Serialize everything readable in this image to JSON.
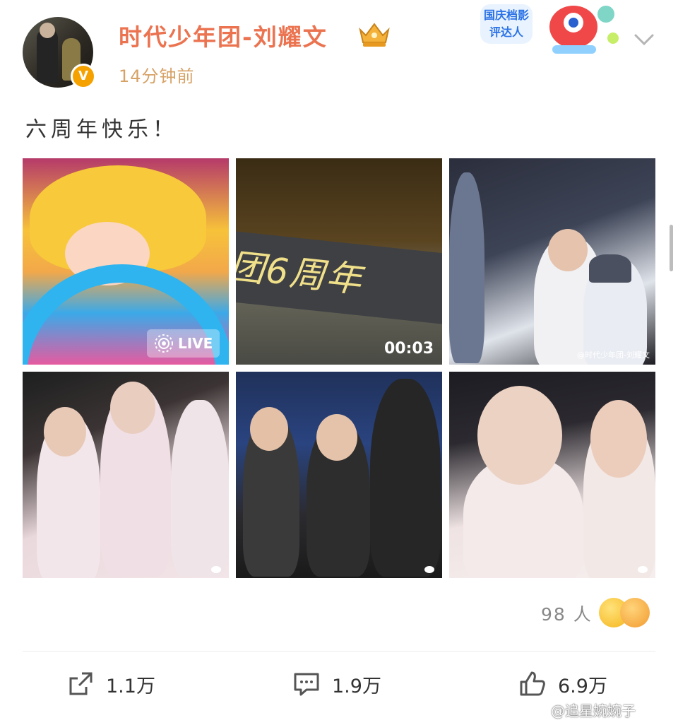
{
  "post": {
    "author": "时代少年团-刘耀文",
    "time": "14分钟前",
    "text": "六周年快乐！",
    "verified_mark": "V",
    "badge_text": "国庆档影评达人"
  },
  "media": [
    {
      "kind": "live-photo",
      "badge": "LIVE"
    },
    {
      "kind": "video",
      "duration": "00:03",
      "banner_text": "团6周年"
    },
    {
      "kind": "photo",
      "watermark": "@时代少年团-刘耀文"
    },
    {
      "kind": "photo"
    },
    {
      "kind": "photo"
    },
    {
      "kind": "photo"
    }
  ],
  "reactions": {
    "count": "98 人"
  },
  "actions": {
    "repost": "1.1万",
    "comment": "1.9万",
    "like": "6.9万"
  },
  "footer_watermark": "@追星婉婉子",
  "colors": {
    "username": "#eb7350",
    "time": "#d6a266",
    "verified": "#f5a200"
  },
  "icons": [
    "crown-badge-icon",
    "chevron-down-icon",
    "live-icon",
    "repost-icon",
    "comment-icon",
    "like-icon",
    "weibo-logo-icon"
  ]
}
